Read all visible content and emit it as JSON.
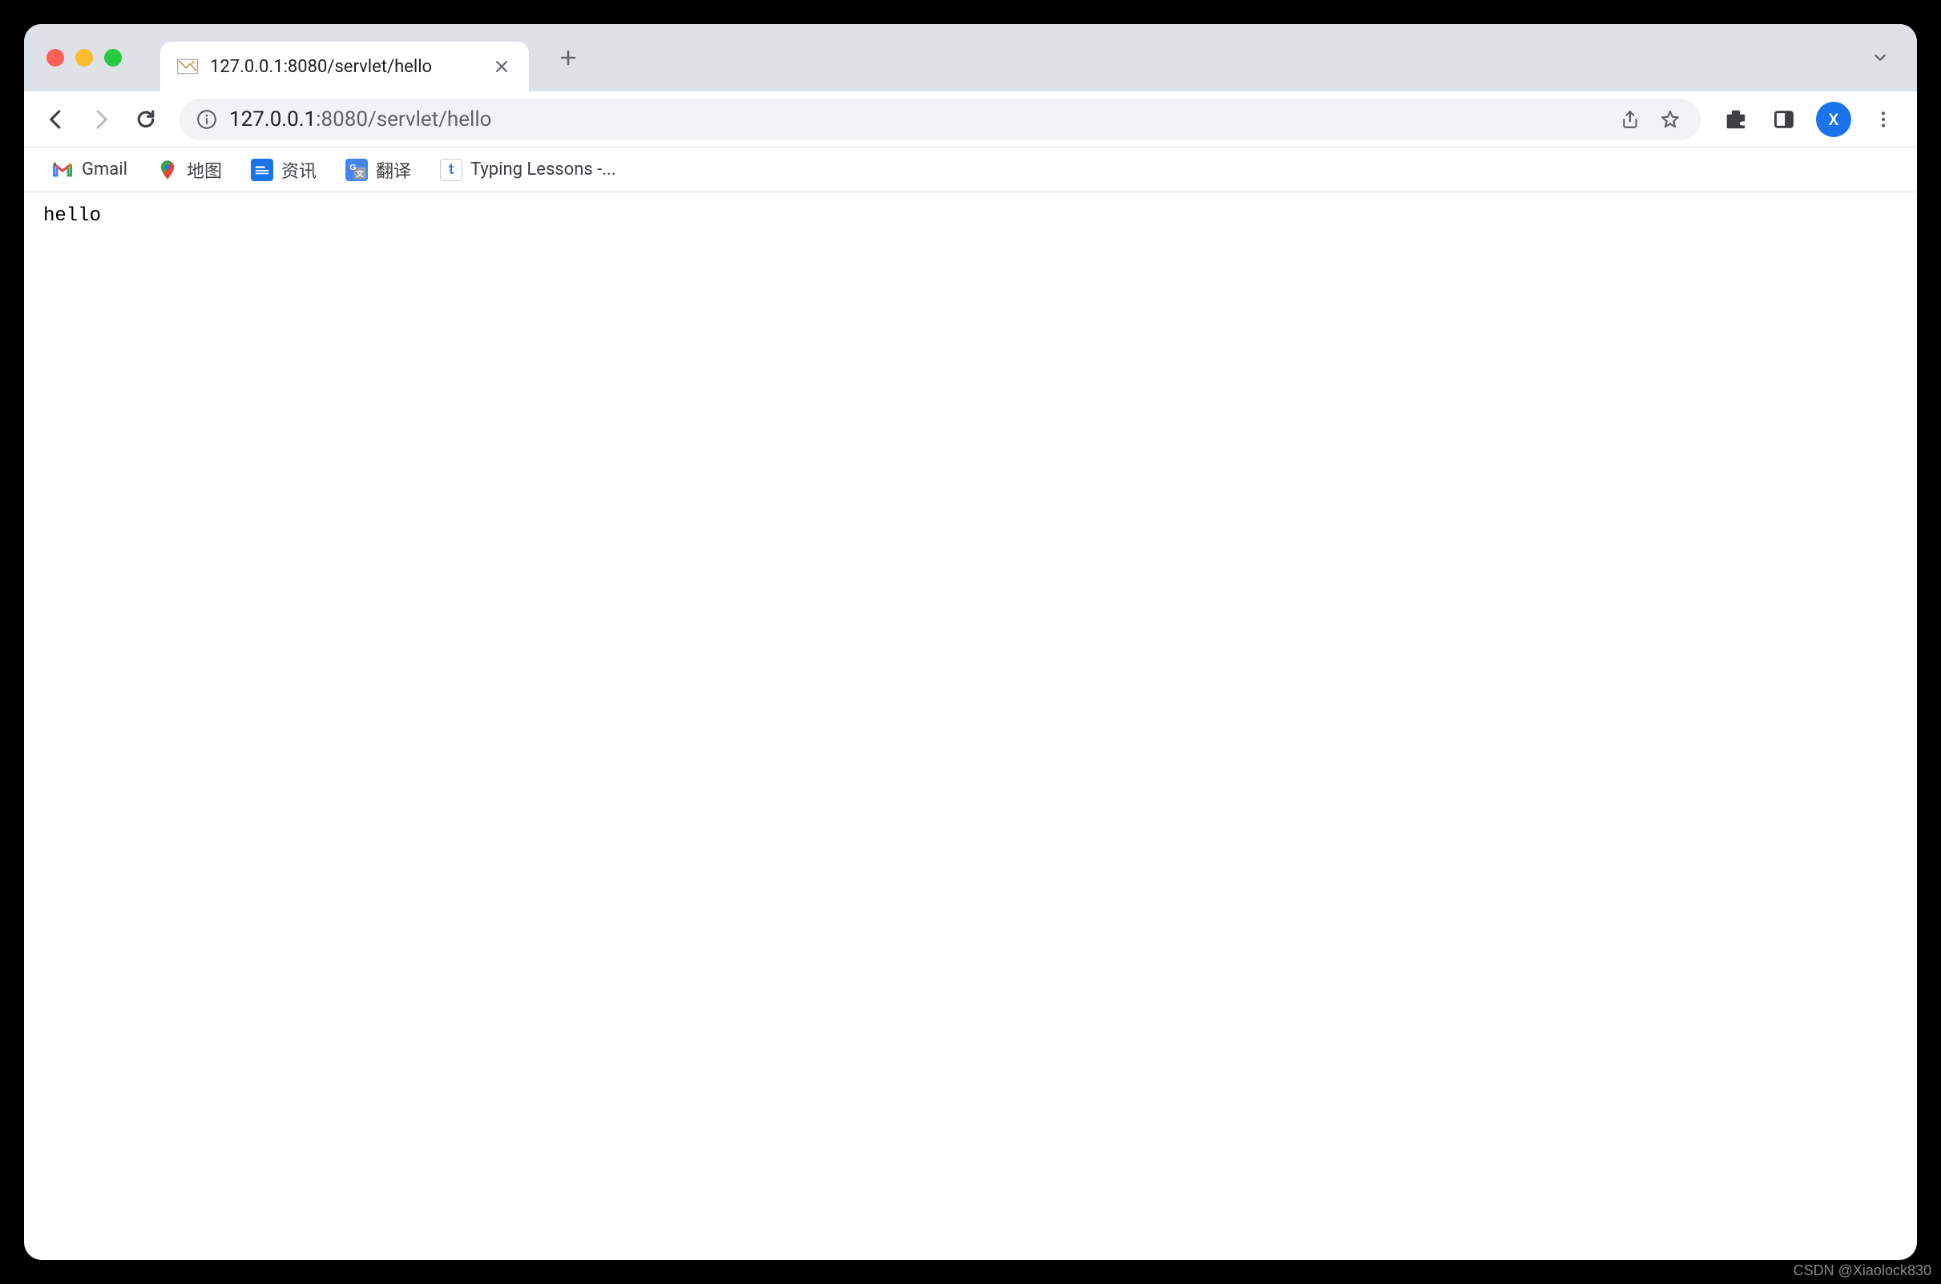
{
  "tab": {
    "title": "127.0.0.1:8080/servlet/hello"
  },
  "address": {
    "host": "127.0.0.1",
    "port_path": ":8080/servlet/hello"
  },
  "profile": {
    "initial": "X"
  },
  "bookmarks": [
    {
      "label": "Gmail"
    },
    {
      "label": "地图"
    },
    {
      "label": "资讯"
    },
    {
      "label": "翻译"
    },
    {
      "label": "Typing Lessons -..."
    }
  ],
  "page": {
    "body_text": "hello"
  },
  "watermark": "CSDN @Xiaolock830"
}
